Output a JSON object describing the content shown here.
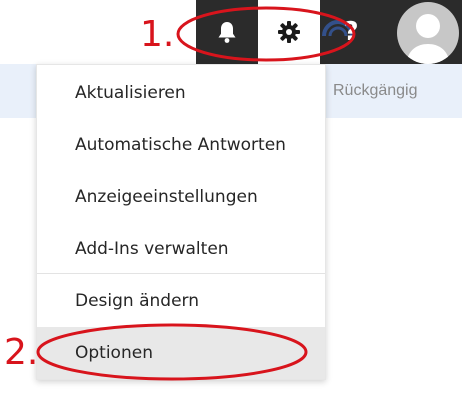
{
  "header": {
    "bell_icon": "bell-icon",
    "gear_icon": "gear-icon",
    "help_label": "?",
    "avatar_icon": "user-avatar-icon"
  },
  "toolbar": {
    "undo_label": "Rückgängig"
  },
  "menu": {
    "items": [
      {
        "label": "Aktualisieren"
      },
      {
        "label": "Automatische Antworten"
      },
      {
        "label": "Anzeigeeinstellungen"
      },
      {
        "label": "Add-Ins verwalten"
      },
      {
        "label": "Design ändern"
      },
      {
        "label": "Optionen",
        "selected": true
      }
    ]
  },
  "annotations": {
    "step1": "1.",
    "step2": "2.",
    "color": "#d8141c"
  }
}
